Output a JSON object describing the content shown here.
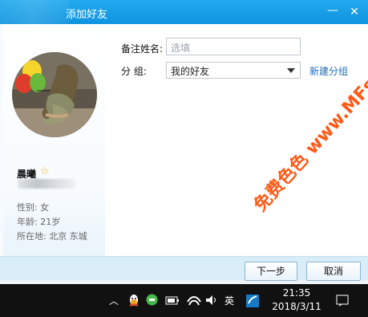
{
  "window": {
    "title": "添加好友",
    "controls": {
      "minimize": "—",
      "close": "✕"
    }
  },
  "profile": {
    "name": "晨曦",
    "gender": "性别: 女",
    "age": "年龄: 21岁",
    "location": "所在地: 北京  东城"
  },
  "form": {
    "remark_label": "备注姓名:",
    "remark_placeholder": "选填",
    "group_label": "分    组:",
    "group_value": "我的好友",
    "new_group": "新建分组"
  },
  "buttons": {
    "next": "下一步",
    "cancel": "取消"
  },
  "taskbar": {
    "time": "21:35",
    "date": "2018/3/11",
    "language": "英",
    "icons": [
      "chevron-up-icon",
      "qq-icon",
      "wechat-icon",
      "battery-icon",
      "wifi-icon",
      "volume-icon",
      "security-icon",
      "notification-icon"
    ]
  },
  "watermark": "免费色色 www.MFsese.com",
  "colors": {
    "titlebar": "#12A2EB",
    "link": "#1E6EB8",
    "footer": "#D9EDF9",
    "watermark": "#FF5A17"
  }
}
